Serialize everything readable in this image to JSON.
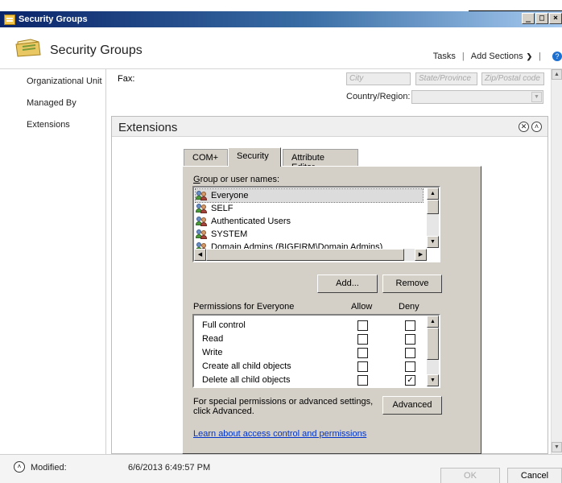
{
  "window": {
    "title": "Security Groups",
    "buttons": {
      "minimize": "_",
      "maximize": "□",
      "close": "×"
    }
  },
  "header": {
    "title": "Security Groups",
    "tasks": "Tasks",
    "add_sections": "Add Sections"
  },
  "nav": {
    "items": [
      "Organizational Unit",
      "Managed By",
      "Extensions"
    ]
  },
  "content": {
    "fax_label": "Fax:",
    "city_placeholder": "City",
    "state_placeholder": "State/Province",
    "zip_placeholder": "Zip/Postal code",
    "country_label": "Country/Region:",
    "country_value": ""
  },
  "extensions": {
    "title": "Extensions",
    "tabs": [
      "COM+",
      "Security",
      "Attribute Editor"
    ],
    "active_tab": "Security",
    "group_label_prefix": "G",
    "group_label_rest": "roup or user names:",
    "users": [
      "Everyone",
      "SELF",
      "Authenticated Users",
      "SYSTEM",
      "Domain Admins (BIGFIRM\\Domain Admins)"
    ],
    "selected_user": "Everyone",
    "add_button": "Add...",
    "remove_button": "Remove",
    "perm_label": "Permissions for Everyone",
    "allow_header": "Allow",
    "deny_header": "Deny",
    "permissions": [
      {
        "name": "Full control",
        "allow": false,
        "deny": false
      },
      {
        "name": "Read",
        "allow": false,
        "deny": false
      },
      {
        "name": "Write",
        "allow": false,
        "deny": false
      },
      {
        "name": "Create all child objects",
        "allow": false,
        "deny": false
      },
      {
        "name": "Delete all child objects",
        "allow": false,
        "deny": true
      }
    ],
    "special_text_1": "For special permissions or advanced settings,",
    "special_text_2": "click Advanced.",
    "advanced_button": "Advanced",
    "learn_link": "Learn about access control and permissions"
  },
  "footer": {
    "modified_label": "Modified:",
    "modified_value": "6/6/2013 6:49:57 PM",
    "ok": "OK",
    "cancel": "Cancel"
  }
}
